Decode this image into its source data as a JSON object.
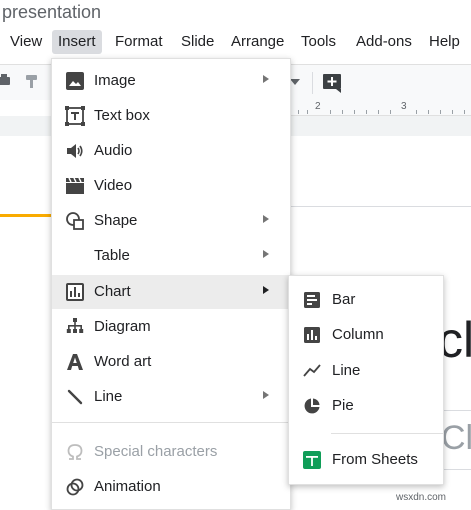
{
  "document": {
    "title": "presentation"
  },
  "menubar": {
    "items": [
      "View",
      "Insert",
      "Format",
      "Slide",
      "Arrange",
      "Tools",
      "Add-ons",
      "Help"
    ]
  },
  "ruler": {
    "mark_2": "2",
    "mark_3": "3"
  },
  "slide": {
    "big_text": "cl",
    "sub_text": "Cli"
  },
  "insert_menu": {
    "items": [
      {
        "label": "Image",
        "icon": "image-icon",
        "submenu": true
      },
      {
        "label": "Text box",
        "icon": "text-box-icon",
        "submenu": false
      },
      {
        "label": "Audio",
        "icon": "audio-icon",
        "submenu": false
      },
      {
        "label": "Video",
        "icon": "video-icon",
        "submenu": false
      },
      {
        "label": "Shape",
        "icon": "shape-icon",
        "submenu": true
      },
      {
        "label": "Table",
        "icon": "",
        "submenu": true
      },
      {
        "label": "Chart",
        "icon": "chart-icon",
        "submenu": true,
        "highlighted": true
      },
      {
        "label": "Diagram",
        "icon": "diagram-icon",
        "submenu": false
      },
      {
        "label": "Word art",
        "icon": "word-art-icon",
        "submenu": false
      },
      {
        "label": "Line",
        "icon": "line-icon",
        "submenu": true
      },
      {
        "label": "Special characters",
        "icon": "omega-icon",
        "submenu": false,
        "disabled": true
      },
      {
        "label": "Animation",
        "icon": "animation-icon",
        "submenu": false
      }
    ]
  },
  "chart_submenu": {
    "items": [
      {
        "label": "Bar",
        "icon": "bar-chart-icon"
      },
      {
        "label": "Column",
        "icon": "column-chart-icon"
      },
      {
        "label": "Line",
        "icon": "line-chart-icon"
      },
      {
        "label": "Pie",
        "icon": "pie-chart-icon"
      },
      {
        "label": "From Sheets",
        "icon": "sheets-icon"
      }
    ]
  },
  "colors": {
    "sheets_green": "#0f9d58",
    "accent_orange": "#f9ab00",
    "menu_hover": "#ececec"
  },
  "watermark": "wsxdn.com"
}
